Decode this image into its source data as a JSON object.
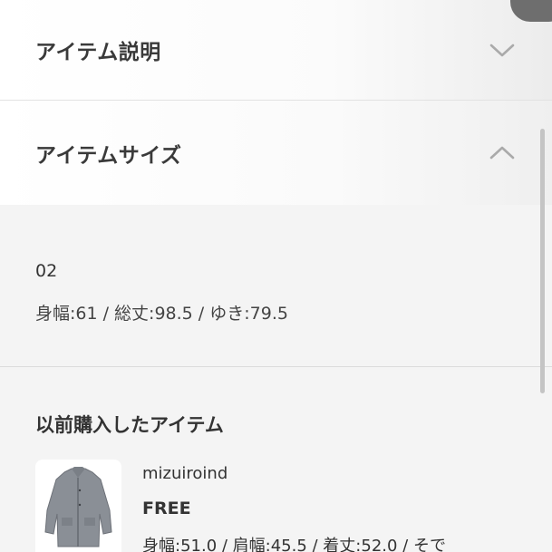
{
  "accordion": {
    "description": {
      "title": "アイテム説明",
      "icon": "chevron-down-icon"
    },
    "size": {
      "title": "アイテムサイズ",
      "icon": "chevron-up-icon"
    }
  },
  "size_info": {
    "size_name": "02",
    "measurements": "身幅:61 / 総丈:98.5 / ゆき:79.5"
  },
  "history": {
    "title": "以前購入したアイテム",
    "items": [
      {
        "brand": "mizuiroind",
        "size": "FREE",
        "measurements": "身幅:51.0 / 肩幅:45.5 / 着丈:52.0 / そで",
        "thumbnail_icon": "jacket-thumbnail"
      }
    ]
  },
  "colors": {
    "accent_bg": "#f4f4f4",
    "chevron": "#aaaaaa",
    "text": "#333333"
  }
}
